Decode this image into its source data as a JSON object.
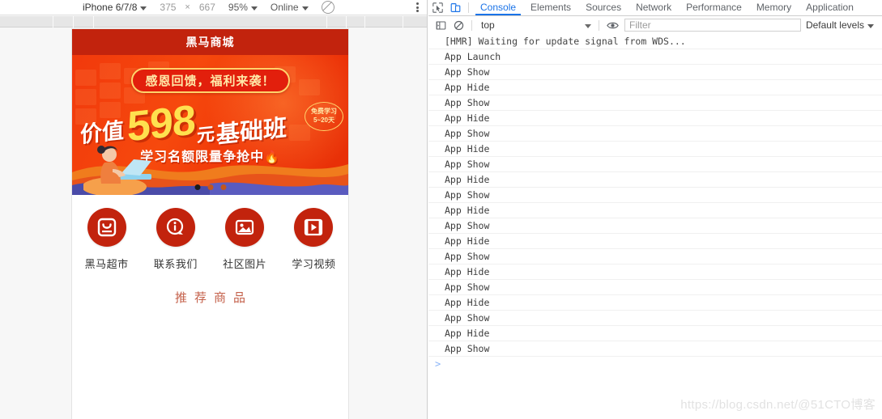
{
  "device_toolbar": {
    "device_name": "iPhone 6/7/8",
    "width": "375",
    "x_symbol": "×",
    "height": "667",
    "zoom": "95%",
    "network": "Online",
    "throttle_icon": "no-throttling-icon",
    "menu_icon": "kebab-menu-icon"
  },
  "preview": {
    "header_title": "黑马商城",
    "banner": {
      "ribbon": "感恩回馈，福利来袭！",
      "price_prefix": "价值",
      "price_number": "598",
      "price_unit": "元",
      "price_suffix": "基础班",
      "badge_line1": "免费学习",
      "badge_line2": "5~20天",
      "subtitle": "学习名额限量争抢中",
      "fire": "🔥",
      "dots_total": 3,
      "dots_active_index": 0
    },
    "nav_items": [
      {
        "label": "黑马超市",
        "icon": "shopping-bag-icon"
      },
      {
        "label": "联系我们",
        "icon": "info-bubble-icon"
      },
      {
        "label": "社区图片",
        "icon": "image-icon"
      },
      {
        "label": "学习视频",
        "icon": "video-play-icon"
      }
    ],
    "section_title": "推荐商品"
  },
  "devtools": {
    "inspect_icon": "inspect-cursor-icon",
    "device_toggle_icon": "device-toolbar-icon",
    "tabs": [
      {
        "label": "Console",
        "active": true
      },
      {
        "label": "Elements",
        "active": false
      },
      {
        "label": "Sources",
        "active": false
      },
      {
        "label": "Network",
        "active": false
      },
      {
        "label": "Performance",
        "active": false
      },
      {
        "label": "Memory",
        "active": false
      },
      {
        "label": "Application",
        "active": false
      }
    ],
    "filterbar": {
      "sidebar_icon": "console-sidebar-icon",
      "clear_icon": "clear-console-icon",
      "context": "top",
      "eye_icon": "live-expression-eye-icon",
      "filter_placeholder": "Filter",
      "levels": "Default levels"
    },
    "messages": [
      "[HMR] Waiting for update signal from WDS...",
      "App Launch",
      "App Show",
      "App Hide",
      "App Show",
      "App Hide",
      "App Show",
      "App Hide",
      "App Show",
      "App Hide",
      "App Show",
      "App Hide",
      "App Show",
      "App Hide",
      "App Show",
      "App Hide",
      "App Show",
      "App Hide",
      "App Show",
      "App Hide",
      "App Show"
    ],
    "prompt": ">",
    "watermark": "https://blog.csdn.net/@51CTO博客"
  }
}
